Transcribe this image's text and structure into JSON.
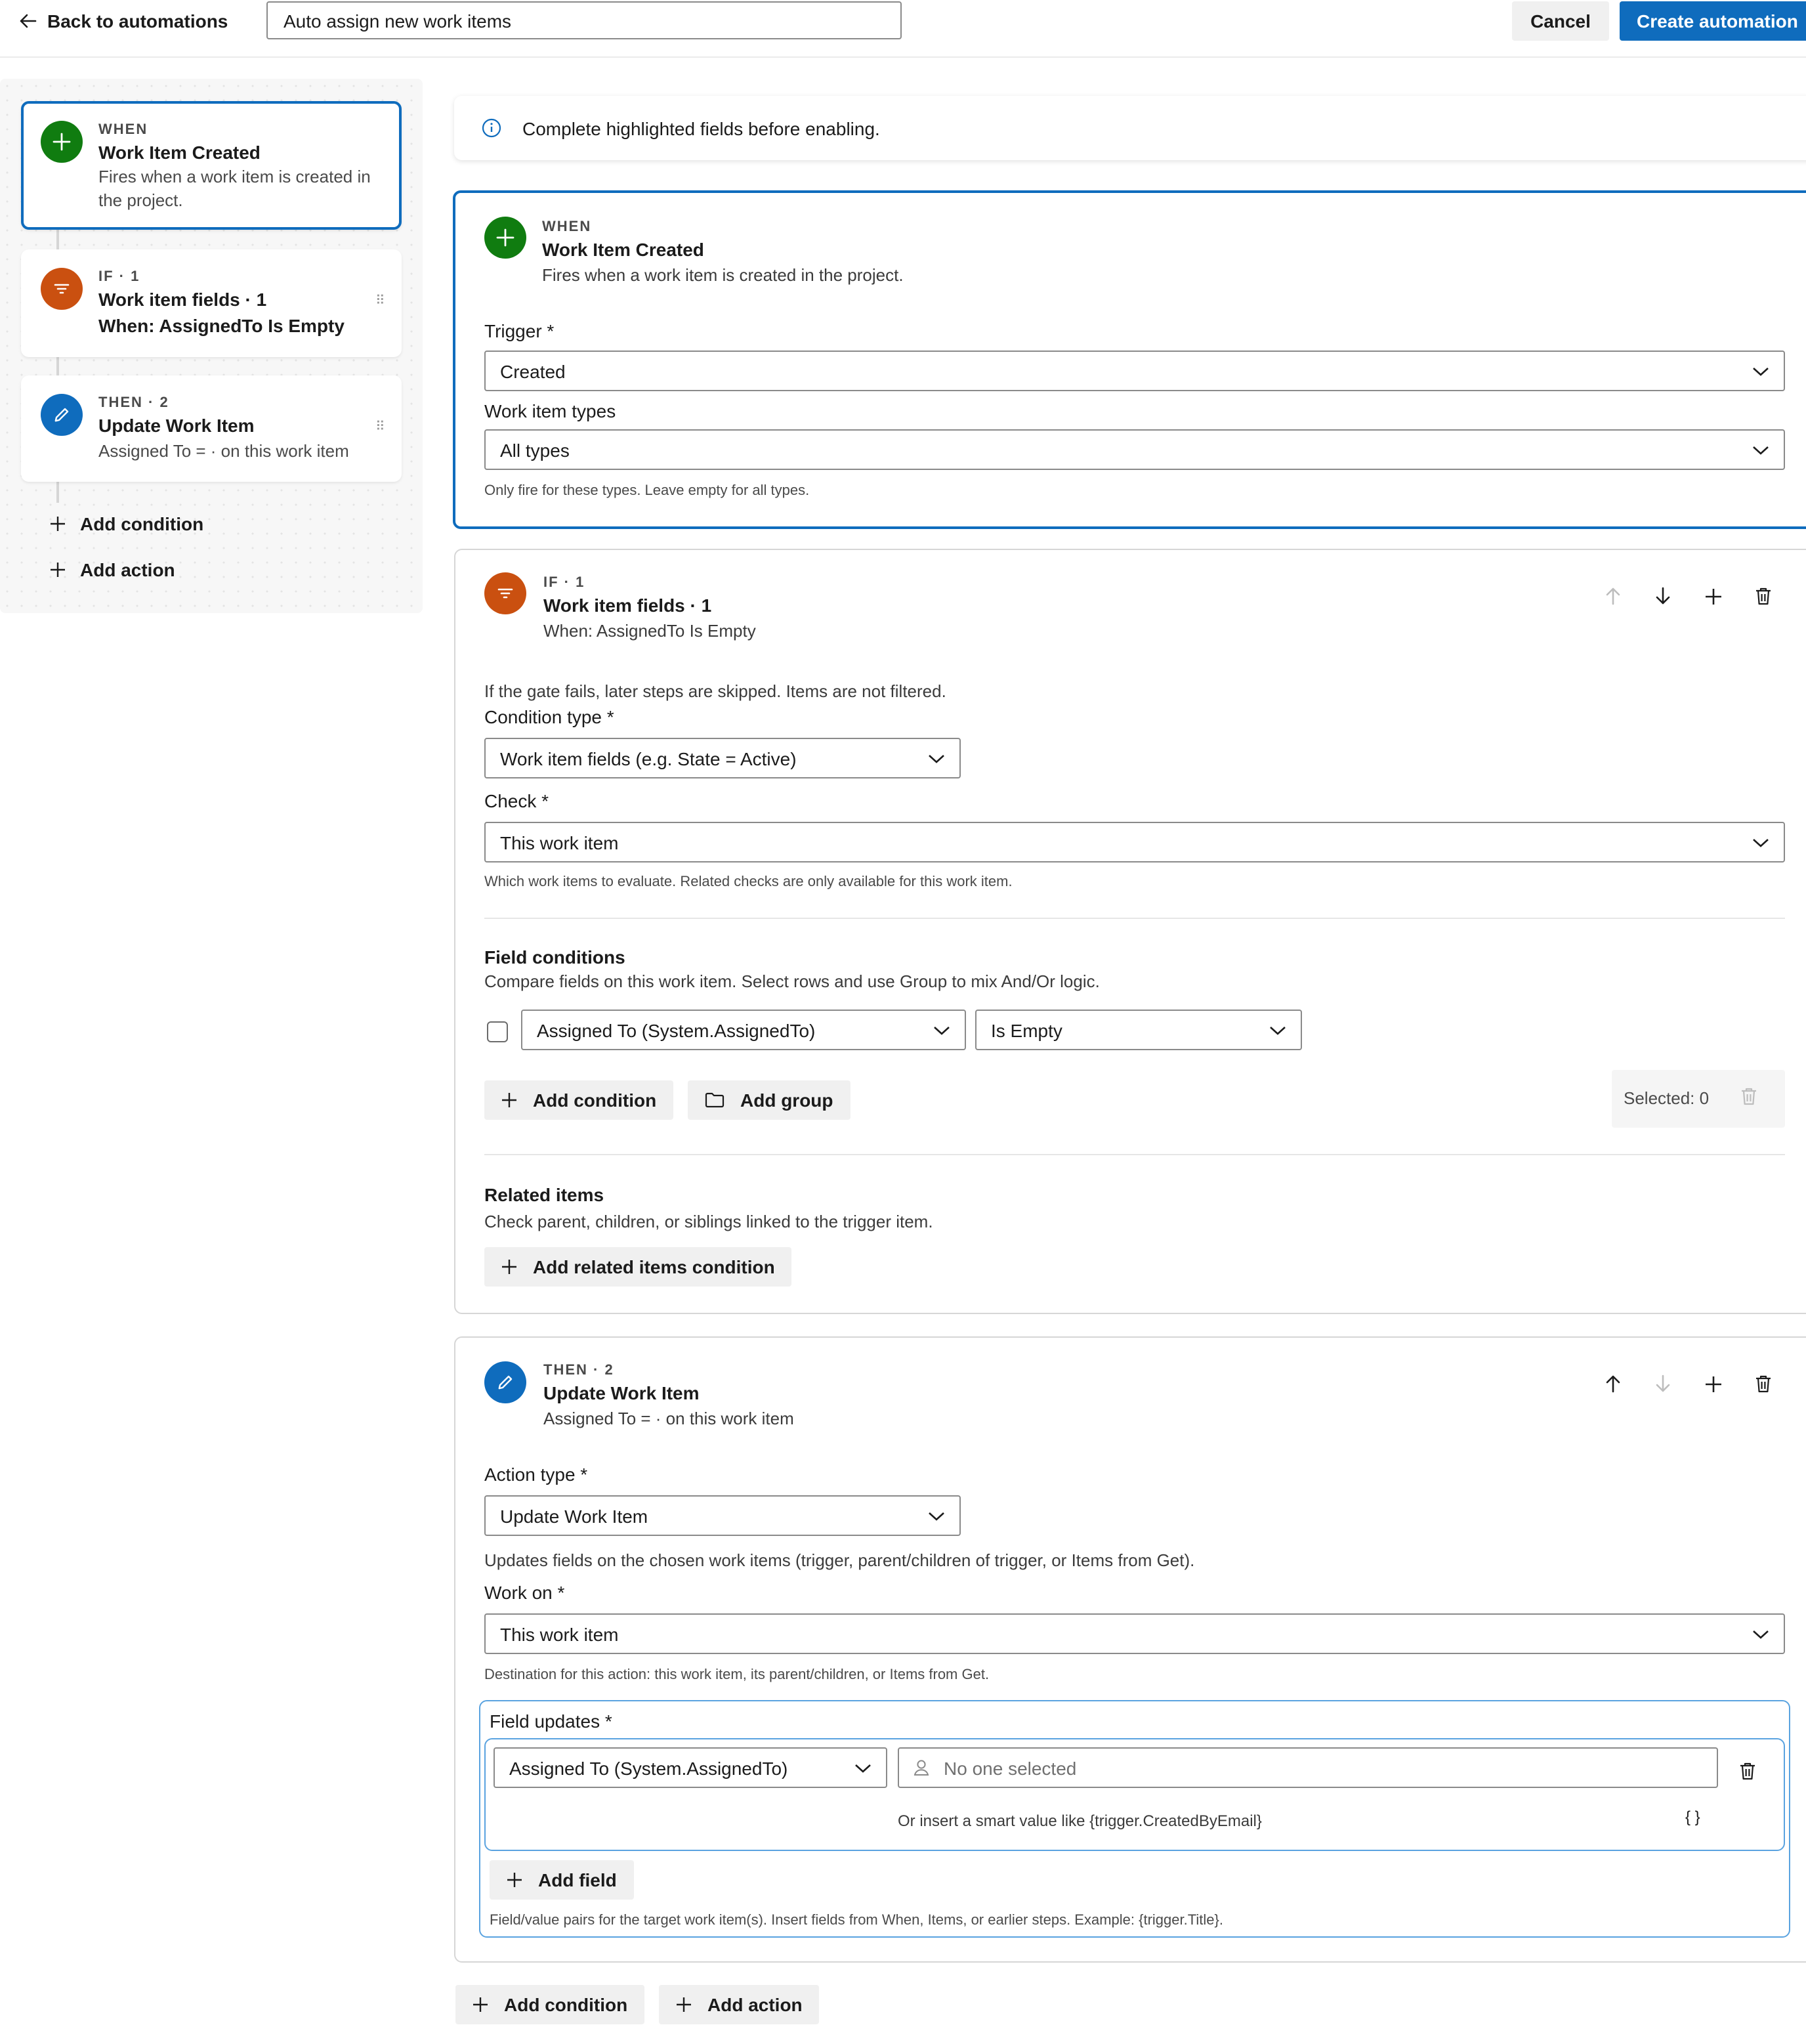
{
  "header": {
    "back_label": "Back to automations",
    "name_value": "Auto assign new work items",
    "cancel_label": "Cancel",
    "create_label": "Create automation"
  },
  "colors": {
    "accent": "#0f6cbd",
    "trigger_green": "#107c10",
    "condition_orange": "#ca5010"
  },
  "sidebar": {
    "items": [
      {
        "kicker": "WHEN",
        "title": "Work Item Created",
        "sub": "Fires when a work item is created in the project.",
        "icon": "plus-icon"
      },
      {
        "kicker": "IF · 1",
        "title": "Work item fields · 1",
        "sub": "When: AssignedTo Is Empty",
        "icon": "filter-icon"
      },
      {
        "kicker": "THEN · 2",
        "title": "Update Work Item",
        "sub": "Assigned To = · on this work item",
        "icon": "pencil-icon"
      }
    ],
    "add_condition": "Add condition",
    "add_action": "Add action"
  },
  "banner": {
    "text": "Complete highlighted fields before enabling."
  },
  "trigger": {
    "kicker": "WHEN",
    "title": "Work Item Created",
    "sub": "Fires when a work item is created in the project.",
    "trigger_label": "Trigger *",
    "trigger_value": "Created",
    "types_label": "Work item types",
    "types_value": "All types",
    "types_help": "Only fire for these types. Leave empty for all types."
  },
  "condition": {
    "kicker": "IF · 1",
    "title": "Work item fields · 1",
    "sub": "When: AssignedTo Is Empty",
    "gate_note": "If the gate fails, later steps are skipped. Items are not filtered.",
    "type_label": "Condition type *",
    "type_value": "Work item fields (e.g. State = Active)",
    "check_label": "Check *",
    "check_value": "This work item",
    "check_help": "Which work items to evaluate. Related checks are only available for this work item.",
    "fields_heading": "Field conditions",
    "fields_desc": "Compare fields on this work item. Select rows and use Group to mix And/Or logic.",
    "row_field": "Assigned To (System.AssignedTo)",
    "row_operator": "Is Empty",
    "add_condition": "Add condition",
    "add_group": "Add group",
    "selected_label": "Selected: 0",
    "related_heading": "Related items",
    "related_desc": "Check parent, children, or siblings linked to the trigger item.",
    "add_related": "Add related items condition"
  },
  "action": {
    "kicker": "THEN · 2",
    "title": "Update Work Item",
    "sub": "Assigned To = · on this work item",
    "type_label": "Action type *",
    "type_value": "Update Work Item",
    "type_desc": "Updates fields on the chosen work items (trigger, parent/children of trigger, or Items from Get).",
    "work_on_label": "Work on *",
    "work_on_value": "This work item",
    "work_on_help": "Destination for this action: this work item, its parent/children, or Items from Get.",
    "updates_label": "Field updates *",
    "update_field": "Assigned To (System.AssignedTo)",
    "update_value_placeholder": "No one selected",
    "smart_hint": "Or insert a smart value like {trigger.CreatedByEmail}",
    "braces": "{ }",
    "add_field": "Add field",
    "updates_help": "Field/value pairs for the target work item(s). Insert fields from When, Items, or earlier steps. Example: {trigger.Title}."
  },
  "footer": {
    "add_condition": "Add condition",
    "add_action": "Add action"
  }
}
